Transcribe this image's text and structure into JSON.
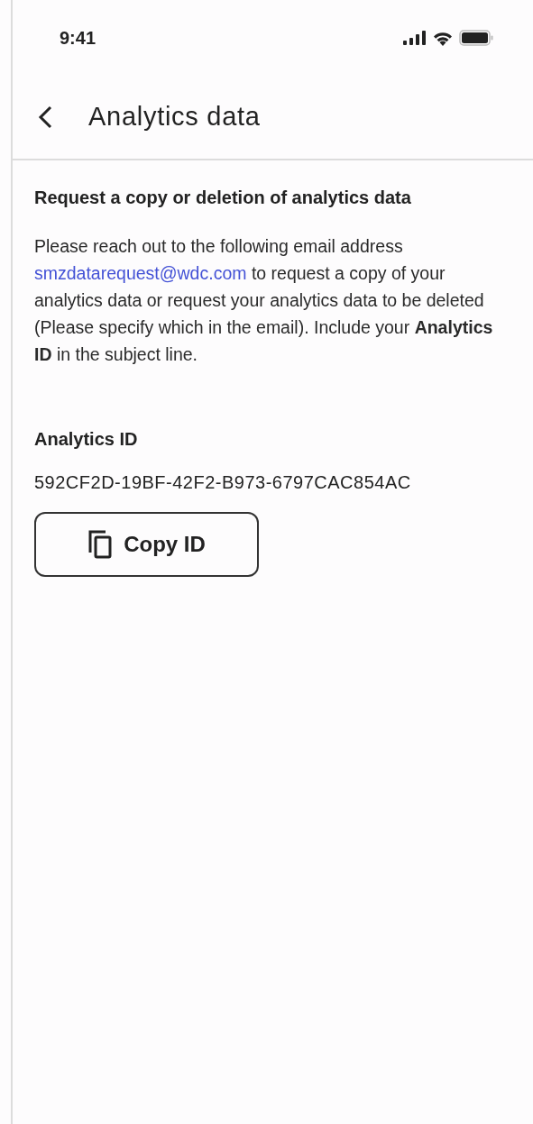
{
  "status_bar": {
    "time": "9:41"
  },
  "header": {
    "title": "Analytics data"
  },
  "section": {
    "heading": "Request a copy or deletion of analytics data",
    "body_before": "Please reach out to the following email address",
    "email": "smzdatarequest@wdc.com",
    "body_after": "to request a copy of your analytics data or request your analytics data to be deleted (Please specify which in the email). Include your **Analytics ID** in the subject line."
  },
  "analytics_id": {
    "label": "Analytics ID",
    "value": "592CF2D-19BF-42F2-B973-6797CAC854AC"
  },
  "copy_button": {
    "label": "Copy ID"
  }
}
